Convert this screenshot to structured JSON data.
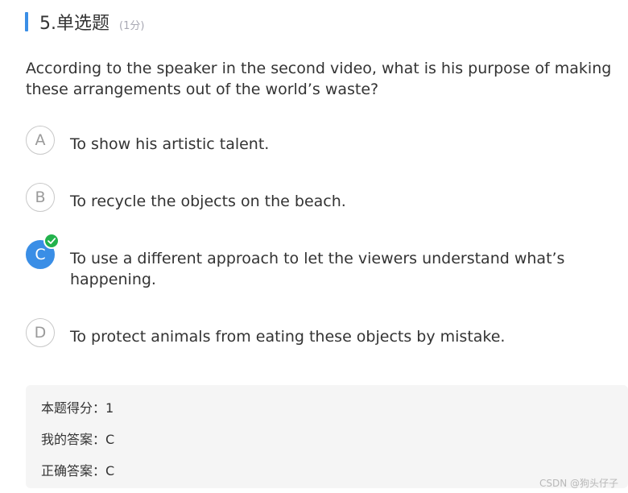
{
  "question": {
    "number_title": "5.单选题",
    "score": "(1分)",
    "text": "According to the speaker in the second video, what is his purpose of making these arrangements out of the world’s waste?"
  },
  "options": [
    {
      "letter": "A",
      "text": "To show his artistic talent.",
      "selected": false
    },
    {
      "letter": "B",
      "text": "To recycle the objects on the beach.",
      "selected": false
    },
    {
      "letter": "C",
      "text": "To use a different approach to let the viewers understand what’s happening.",
      "selected": true,
      "correct": true
    },
    {
      "letter": "D",
      "text": "To protect animals from eating these objects by mistake.",
      "selected": false
    }
  ],
  "result": {
    "score_line": "本题得分：1",
    "my_answer_line": "我的答案：C",
    "correct_answer_line": "正确答案：C"
  },
  "watermark": "CSDN @狗头仔子",
  "colors": {
    "accent": "#3a8ee6",
    "correct_badge": "#22b24c",
    "result_bg": "#f5f5f5"
  }
}
